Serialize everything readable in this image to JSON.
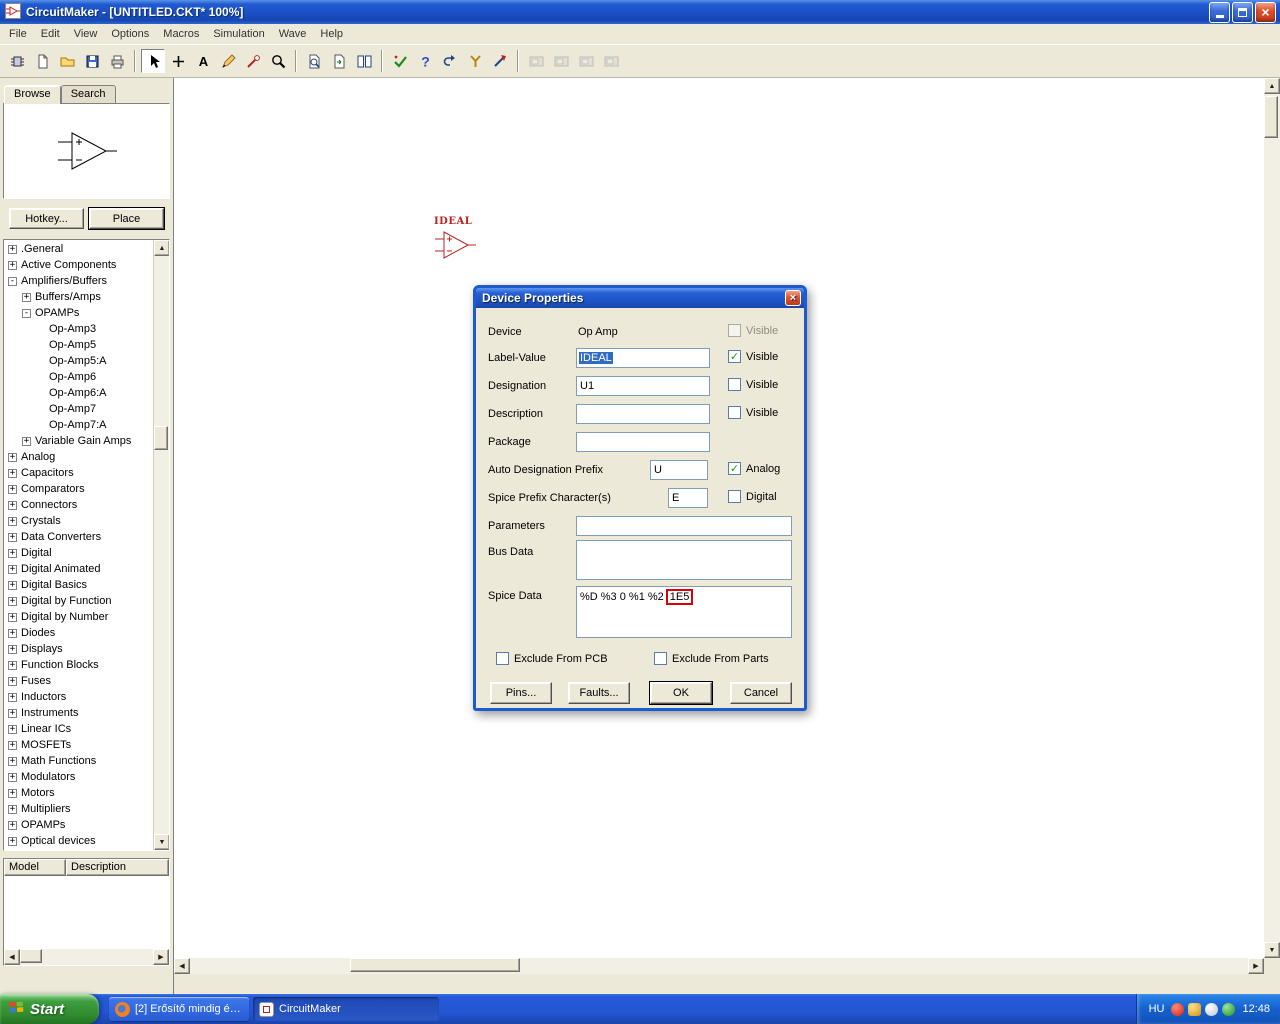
{
  "window": {
    "title": "CircuitMaker - [UNTITLED.CKT* 100%]"
  },
  "menu": {
    "items": [
      "File",
      "Edit",
      "View",
      "Options",
      "Macros",
      "Simulation",
      "Wave",
      "Help"
    ]
  },
  "toolbar": {
    "buttons": [
      {
        "name": "parts-browser-button",
        "icon": "chip"
      },
      {
        "name": "new-file-button",
        "icon": "newdoc"
      },
      {
        "name": "open-file-button",
        "icon": "folder"
      },
      {
        "name": "save-file-button",
        "icon": "floppy"
      },
      {
        "name": "print-button",
        "icon": "printer"
      },
      {
        "sep": true
      },
      {
        "name": "arrow-tool-button",
        "icon": "cursor",
        "pressed": true
      },
      {
        "name": "wire-tool-button",
        "icon": "plus"
      },
      {
        "name": "text-tool-button",
        "icon": "textA"
      },
      {
        "name": "edit-tool-button",
        "icon": "pencil"
      },
      {
        "name": "probe-tool-button",
        "icon": "probe"
      },
      {
        "name": "zoom-tool-button",
        "icon": "zoom"
      },
      {
        "sep": true
      },
      {
        "name": "part-search-button",
        "icon": "zoomdoc"
      },
      {
        "name": "refresh-screen-button",
        "icon": "pagearrow"
      },
      {
        "name": "split-view-button",
        "icon": "panes"
      },
      {
        "sep": true
      },
      {
        "name": "rule-check-button",
        "icon": "check"
      },
      {
        "name": "help-mode-button",
        "icon": "question"
      },
      {
        "name": "reset-simulation-button",
        "icon": "undo"
      },
      {
        "name": "scope-probe-button",
        "icon": "scope"
      },
      {
        "name": "run-simulation-button",
        "icon": "runarrow"
      },
      {
        "sep": true
      },
      {
        "name": "digital-instrument-1-button",
        "icon": "inst",
        "disabled": true
      },
      {
        "name": "digital-instrument-2-button",
        "icon": "inst",
        "disabled": true
      },
      {
        "name": "digital-instrument-3-button",
        "icon": "inst",
        "disabled": true
      },
      {
        "name": "digital-instrument-4-button",
        "icon": "inst",
        "disabled": true
      }
    ]
  },
  "sidebar": {
    "tabs": [
      {
        "label": "Browse",
        "active": true
      },
      {
        "label": "Search",
        "active": false
      }
    ],
    "hotkey_button": "Hotkey...",
    "place_button": "Place",
    "tree": [
      {
        "label": ".General",
        "level": 0,
        "sign": "+"
      },
      {
        "label": "Active Components",
        "level": 0,
        "sign": "+"
      },
      {
        "label": "Amplifiers/Buffers",
        "level": 0,
        "sign": "-"
      },
      {
        "label": "Buffers/Amps",
        "level": 1,
        "sign": "+"
      },
      {
        "label": "OPAMPs",
        "level": 1,
        "sign": "-"
      },
      {
        "label": "Op-Amp3",
        "level": 2,
        "sign": ""
      },
      {
        "label": "Op-Amp5",
        "level": 2,
        "sign": ""
      },
      {
        "label": "Op-Amp5:A",
        "level": 2,
        "sign": ""
      },
      {
        "label": "Op-Amp6",
        "level": 2,
        "sign": ""
      },
      {
        "label": "Op-Amp6:A",
        "level": 2,
        "sign": ""
      },
      {
        "label": "Op-Amp7",
        "level": 2,
        "sign": ""
      },
      {
        "label": "Op-Amp7:A",
        "level": 2,
        "sign": ""
      },
      {
        "label": "Variable Gain Amps",
        "level": 1,
        "sign": "+"
      },
      {
        "label": "Analog",
        "level": 0,
        "sign": "+"
      },
      {
        "label": "Capacitors",
        "level": 0,
        "sign": "+"
      },
      {
        "label": "Comparators",
        "level": 0,
        "sign": "+"
      },
      {
        "label": "Connectors",
        "level": 0,
        "sign": "+"
      },
      {
        "label": "Crystals",
        "level": 0,
        "sign": "+"
      },
      {
        "label": "Data Converters",
        "level": 0,
        "sign": "+"
      },
      {
        "label": "Digital",
        "level": 0,
        "sign": "+"
      },
      {
        "label": "Digital Animated",
        "level": 0,
        "sign": "+"
      },
      {
        "label": "Digital Basics",
        "level": 0,
        "sign": "+"
      },
      {
        "label": "Digital by Function",
        "level": 0,
        "sign": "+"
      },
      {
        "label": "Digital by Number",
        "level": 0,
        "sign": "+"
      },
      {
        "label": "Diodes",
        "level": 0,
        "sign": "+"
      },
      {
        "label": "Displays",
        "level": 0,
        "sign": "+"
      },
      {
        "label": "Function Blocks",
        "level": 0,
        "sign": "+"
      },
      {
        "label": "Fuses",
        "level": 0,
        "sign": "+"
      },
      {
        "label": "Inductors",
        "level": 0,
        "sign": "+"
      },
      {
        "label": "Instruments",
        "level": 0,
        "sign": "+"
      },
      {
        "label": "Linear ICs",
        "level": 0,
        "sign": "+"
      },
      {
        "label": "MOSFETs",
        "level": 0,
        "sign": "+"
      },
      {
        "label": "Math Functions",
        "level": 0,
        "sign": "+"
      },
      {
        "label": "Modulators",
        "level": 0,
        "sign": "+"
      },
      {
        "label": "Motors",
        "level": 0,
        "sign": "+"
      },
      {
        "label": "Multipliers",
        "level": 0,
        "sign": "+"
      },
      {
        "label": "OPAMPs",
        "level": 0,
        "sign": "+"
      },
      {
        "label": "Optical devices",
        "level": 0,
        "sign": "+"
      }
    ],
    "model_panel": {
      "columns": [
        "Model",
        "Description"
      ]
    }
  },
  "canvas": {
    "part_label": "IDEAL",
    "part_color": "#C02020"
  },
  "dialog": {
    "title": "Device Properties",
    "fields": {
      "device": {
        "label": "Device",
        "value": "Op Amp",
        "visible_label": "Visible"
      },
      "label_value": {
        "label": "Label-Value",
        "value": "IDEAL",
        "visible_label": "Visible"
      },
      "designation": {
        "label": "Designation",
        "value": "U1",
        "visible_label": "Visible"
      },
      "description": {
        "label": "Description",
        "value": "",
        "visible_label": "Visible"
      },
      "package": {
        "label": "Package",
        "value": ""
      },
      "auto_prefix": {
        "label": "Auto Designation Prefix",
        "value": "U",
        "check_label": "Analog"
      },
      "spice_prefix": {
        "label": "Spice Prefix Character(s)",
        "value": "E",
        "check_label": "Digital"
      },
      "parameters": {
        "label": "Parameters",
        "value": ""
      },
      "bus_data": {
        "label": "Bus Data",
        "value": ""
      },
      "spice_data": {
        "label": "Spice Data",
        "value_pre": "%D %3 0 %1 %2",
        "value_marked": "1E5",
        "highlight_color": "#E00000"
      }
    },
    "exclude_pcb": "Exclude From PCB",
    "exclude_parts": "Exclude From Parts",
    "buttons": {
      "pins": "Pins...",
      "faults": "Faults...",
      "ok": "OK",
      "cancel": "Cancel"
    }
  },
  "taskbar": {
    "start_label": "Start",
    "tasks": [
      {
        "label": "[2] Erősítő mindig és ...",
        "icon": "firefox"
      },
      {
        "label": "CircuitMaker",
        "icon": "cm",
        "active": true
      }
    ],
    "tray": {
      "language": "HU",
      "time": "12:48",
      "icons": [
        {
          "name": "security-alert-icon",
          "shape": "red"
        },
        {
          "name": "update-icon",
          "shape": "gold"
        },
        {
          "name": "volume-icon",
          "shape": "white"
        },
        {
          "name": "network-status-icon",
          "shape": "green"
        }
      ]
    }
  }
}
